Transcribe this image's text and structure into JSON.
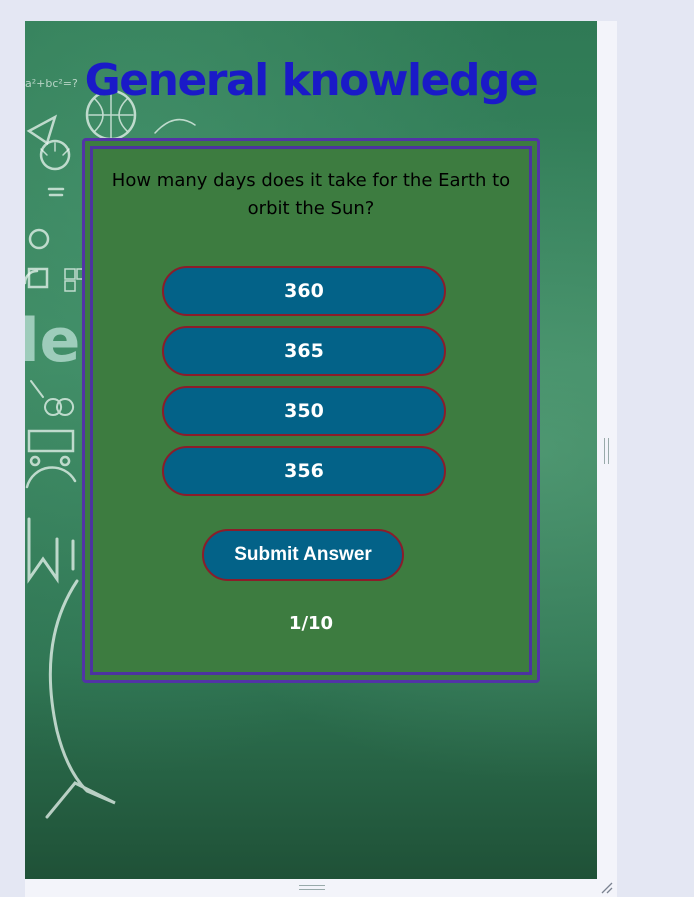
{
  "quiz": {
    "title": "General knowledge",
    "question": "How many days does it take for the Earth to orbit the Sun?",
    "answers": [
      "360",
      "365",
      "350",
      "356"
    ],
    "submit_label": "Submit Answer",
    "progress": "1/10"
  },
  "decoration": {
    "chalk_word": "ledge",
    "chalk_formula": "a²+bc²=?"
  },
  "colors": {
    "title": "#1a1ac8",
    "button_bg": "#036288",
    "button_border": "#8b1d2a",
    "card_border": "#5234a6",
    "card_bg": "#3d7c40"
  }
}
